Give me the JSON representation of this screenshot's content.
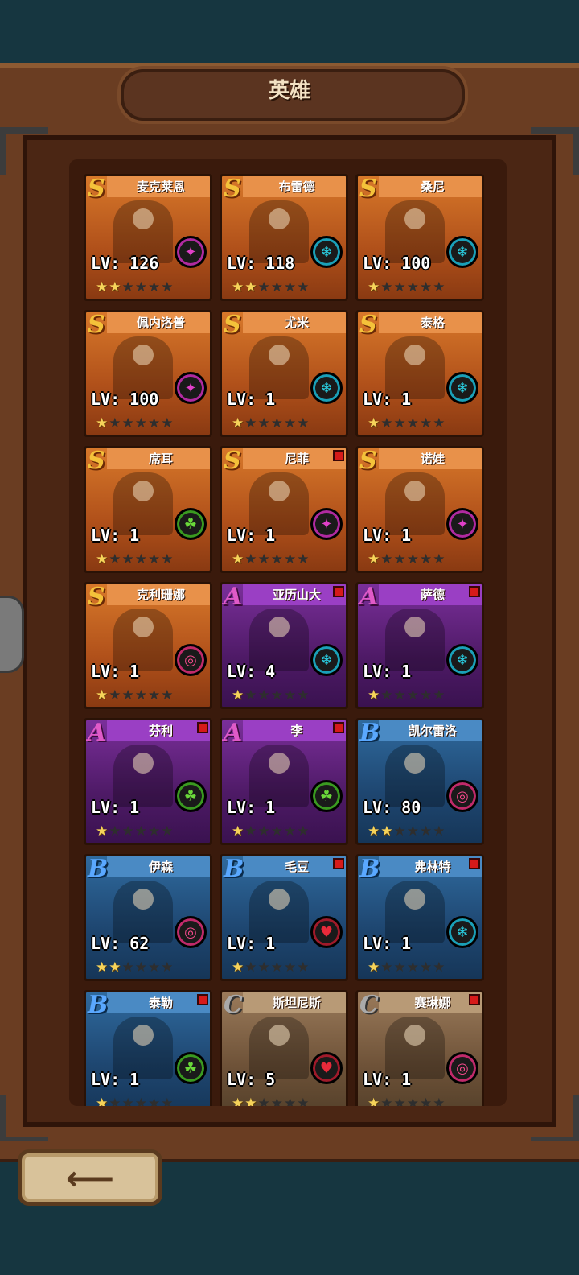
{
  "header": {
    "title": "英雄"
  },
  "heroes": [
    {
      "name": "麦克莱恩",
      "rank": "S",
      "level": "LV: 126",
      "stars": 2,
      "role": "magic-icon",
      "badge": false
    },
    {
      "name": "布雷德",
      "rank": "S",
      "level": "LV: 118",
      "stars": 2,
      "role": "ice-icon",
      "badge": false
    },
    {
      "name": "桑尼",
      "rank": "S",
      "level": "LV: 100",
      "stars": 1,
      "role": "ice-icon",
      "badge": false
    },
    {
      "name": "佩内洛普",
      "rank": "S",
      "level": "LV: 100",
      "stars": 1,
      "role": "magic-icon",
      "badge": false
    },
    {
      "name": "尤米",
      "rank": "S",
      "level": "LV: 1",
      "stars": 1,
      "role": "ice-icon",
      "badge": false
    },
    {
      "name": "泰格",
      "rank": "S",
      "level": "LV: 1",
      "stars": 1,
      "role": "ice-icon",
      "badge": false
    },
    {
      "name": "席耳",
      "rank": "S",
      "level": "LV: 1",
      "stars": 1,
      "role": "nature-icon",
      "badge": false
    },
    {
      "name": "尼菲",
      "rank": "S",
      "level": "LV: 1",
      "stars": 1,
      "role": "magic-icon",
      "badge": true
    },
    {
      "name": "诺娃",
      "rank": "S",
      "level": "LV: 1",
      "stars": 1,
      "role": "magic-icon",
      "badge": false
    },
    {
      "name": "克利珊娜",
      "rank": "S",
      "level": "LV: 1",
      "stars": 1,
      "role": "target-icon",
      "badge": false
    },
    {
      "name": "亚历山大",
      "rank": "A",
      "level": "LV: 4",
      "stars": 1,
      "role": "ice-icon",
      "badge": true
    },
    {
      "name": "萨德",
      "rank": "A",
      "level": "LV: 1",
      "stars": 1,
      "role": "ice-icon",
      "badge": true
    },
    {
      "name": "芬利",
      "rank": "A",
      "level": "LV: 1",
      "stars": 1,
      "role": "nature-icon",
      "badge": true
    },
    {
      "name": "李",
      "rank": "A",
      "level": "LV: 1",
      "stars": 1,
      "role": "nature-icon",
      "badge": true
    },
    {
      "name": "凯尔雷洛",
      "rank": "B",
      "level": "LV: 80",
      "stars": 2,
      "role": "target-icon",
      "badge": false
    },
    {
      "name": "伊森",
      "rank": "B",
      "level": "LV: 62",
      "stars": 2,
      "role": "target-icon",
      "badge": false
    },
    {
      "name": "毛豆",
      "rank": "B",
      "level": "LV: 1",
      "stars": 1,
      "role": "fire-icon",
      "badge": true
    },
    {
      "name": "弗林特",
      "rank": "B",
      "level": "LV: 1",
      "stars": 1,
      "role": "ice-icon",
      "badge": true
    },
    {
      "name": "泰勒",
      "rank": "B",
      "level": "LV: 1",
      "stars": 1,
      "role": "nature-icon",
      "badge": true
    },
    {
      "name": "斯坦尼斯",
      "rank": "C",
      "level": "LV: 5",
      "stars": 2,
      "role": "fire-icon",
      "badge": false
    },
    {
      "name": "赛琳娜",
      "rank": "C",
      "level": "LV: 1",
      "stars": 1,
      "role": "target-icon",
      "badge": true
    }
  ],
  "max_stars": 6,
  "colors": {
    "rank_S": "#d7782a",
    "rank_A": "#7a2f9a",
    "rank_B": "#2f6a9e",
    "rank_C": "#9a7a5a",
    "badge": "#d61a1a"
  }
}
